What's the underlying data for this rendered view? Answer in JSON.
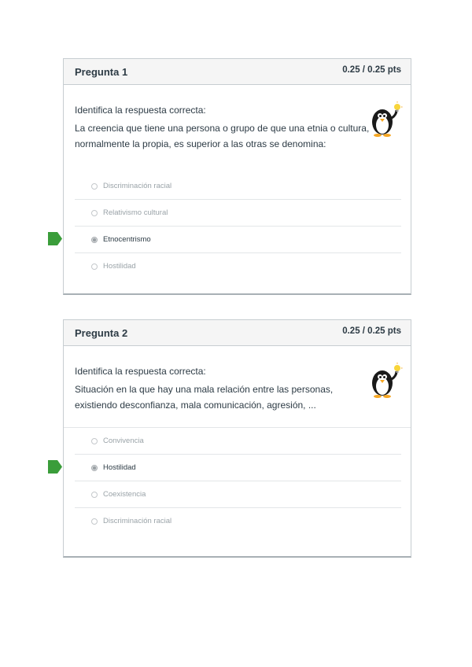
{
  "questions": [
    {
      "title": "Pregunta 1",
      "points": "0.25 / 0.25 pts",
      "instruction": "Identifica la respuesta correcta:",
      "text": "La creencia que tiene una persona o grupo de que una etnia o cultura, normalmente la propia, es superior a las otras se denomina:",
      "answers": [
        "Discriminación racial",
        "Relativismo cultural",
        "Etnocentrismo",
        "Hostilidad"
      ],
      "selected_index": 2
    },
    {
      "title": "Pregunta 2",
      "points": "0.25 / 0.25 pts",
      "instruction": "Identifica la respuesta correcta:",
      "text": "Situación en la que hay una mala relación entre las personas, existiendo desconfianza, mala comunicación, agresión, ...",
      "answers": [
        "Convivencia",
        "Hostilidad",
        "Coexistencia",
        "Discriminación racial"
      ],
      "selected_index": 1
    }
  ],
  "colors": {
    "correct_flag": "#3a9d3a",
    "header_bg": "#f5f5f5",
    "text": "#2d3b45",
    "muted_text": "#9aa3a8"
  },
  "icons": {
    "mascot": "penguin-lightbulb-icon",
    "correct_marker": "correct-answer-flag-icon"
  }
}
